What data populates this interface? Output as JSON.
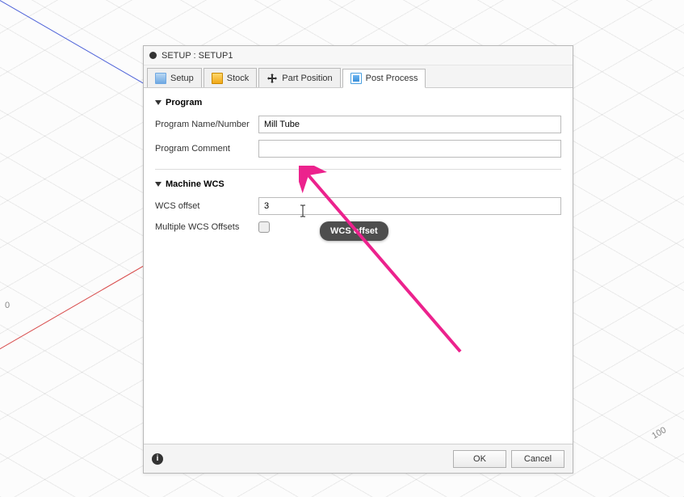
{
  "grid": {
    "label_100": "100",
    "label_0": "0"
  },
  "dialog": {
    "title": "SETUP : SETUP1",
    "tabs": {
      "setup": "Setup",
      "stock": "Stock",
      "part_position": "Part Position",
      "post_process": "Post Process"
    },
    "sections": {
      "program": {
        "title": "Program",
        "name_label": "Program Name/Number",
        "name_value": "Mill Tube",
        "comment_label": "Program Comment",
        "comment_value": ""
      },
      "machine_wcs": {
        "title": "Machine WCS",
        "offset_label": "WCS offset",
        "offset_value": "3",
        "multiple_label": "Multiple WCS Offsets"
      }
    },
    "tooltip": "WCS offset",
    "buttons": {
      "ok": "OK",
      "cancel": "Cancel"
    }
  }
}
